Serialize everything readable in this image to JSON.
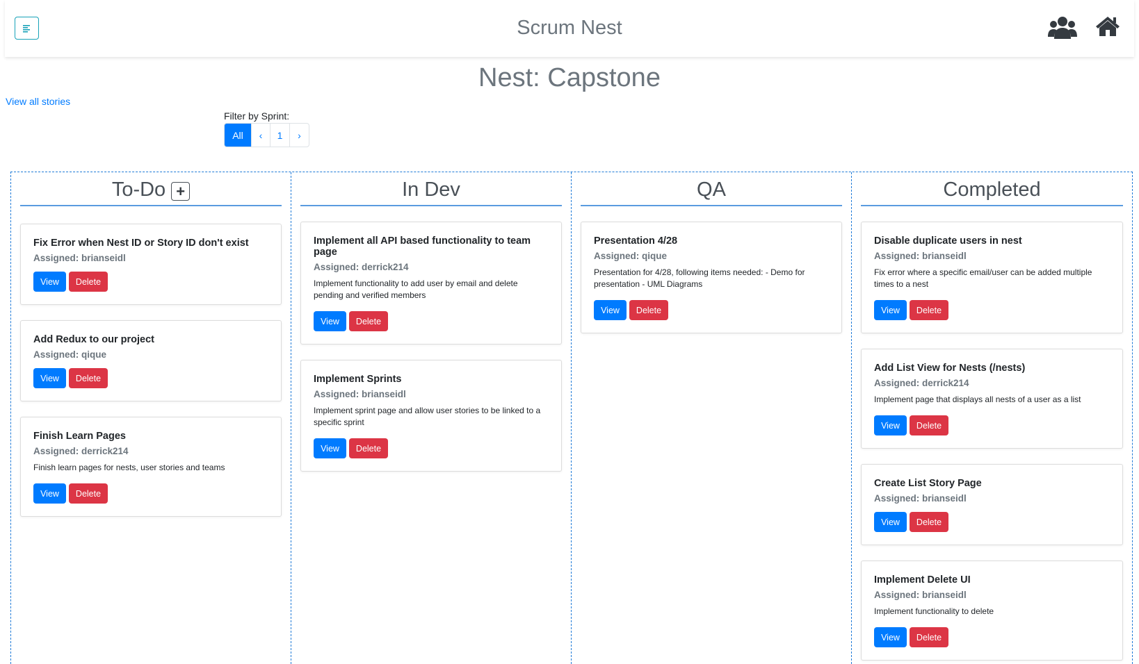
{
  "header": {
    "app_title": "Scrum Nest",
    "menu_icon": "menu-icon",
    "team_icon": "users-icon",
    "home_icon": "home-icon"
  },
  "page": {
    "title": "Nest: Capstone",
    "view_all_link": "View all stories",
    "filter_label": "Filter by Sprint:"
  },
  "pagination": {
    "all": "All",
    "prev": "‹",
    "page1": "1",
    "next": "›"
  },
  "buttons": {
    "view": "View",
    "delete": "Delete",
    "add": "+"
  },
  "colors": {
    "primary": "#007bff",
    "danger": "#dc3545",
    "board_border": "#1e7ad8"
  },
  "columns": [
    {
      "title": "To-Do",
      "cards": [
        {
          "title": "Fix Error when Nest ID or Story ID don't exist",
          "assigned": "Assigned: brianseidl",
          "desc": ""
        },
        {
          "title": "Add Redux to our project",
          "assigned": "Assigned: qique",
          "desc": ""
        },
        {
          "title": "Finish Learn Pages",
          "assigned": "Assigned: derrick214",
          "desc": "Finish learn pages for nests, user stories and teams"
        }
      ]
    },
    {
      "title": "In Dev",
      "cards": [
        {
          "title": "Implement all API based functionality to team page",
          "assigned": "Assigned: derrick214",
          "desc": "Implement functionality to add user by email and delete pending and verified members"
        },
        {
          "title": "Implement Sprints",
          "assigned": "Assigned: brianseidl",
          "desc": "Implement sprint page and allow user stories to be linked to a specific sprint"
        }
      ]
    },
    {
      "title": "QA",
      "cards": [
        {
          "title": "Presentation 4/28",
          "assigned": "Assigned: qique",
          "desc": "Presentation for 4/28, following items needed: - Demo for presentation - UML Diagrams"
        }
      ]
    },
    {
      "title": "Completed",
      "cards": [
        {
          "title": "Disable duplicate users in nest",
          "assigned": "Assigned: brianseidl",
          "desc": "Fix error where a specific email/user can be added multiple times to a nest"
        },
        {
          "title": "Add List View for Nests (/nests)",
          "assigned": "Assigned: derrick214",
          "desc": "Implement page that displays all nests of a user as a list"
        },
        {
          "title": "Create List Story Page",
          "assigned": "Assigned: brianseidl",
          "desc": ""
        },
        {
          "title": "Implement Delete UI",
          "assigned": "Assigned: brianseidl",
          "desc": "Implement functionality to delete"
        }
      ]
    }
  ]
}
